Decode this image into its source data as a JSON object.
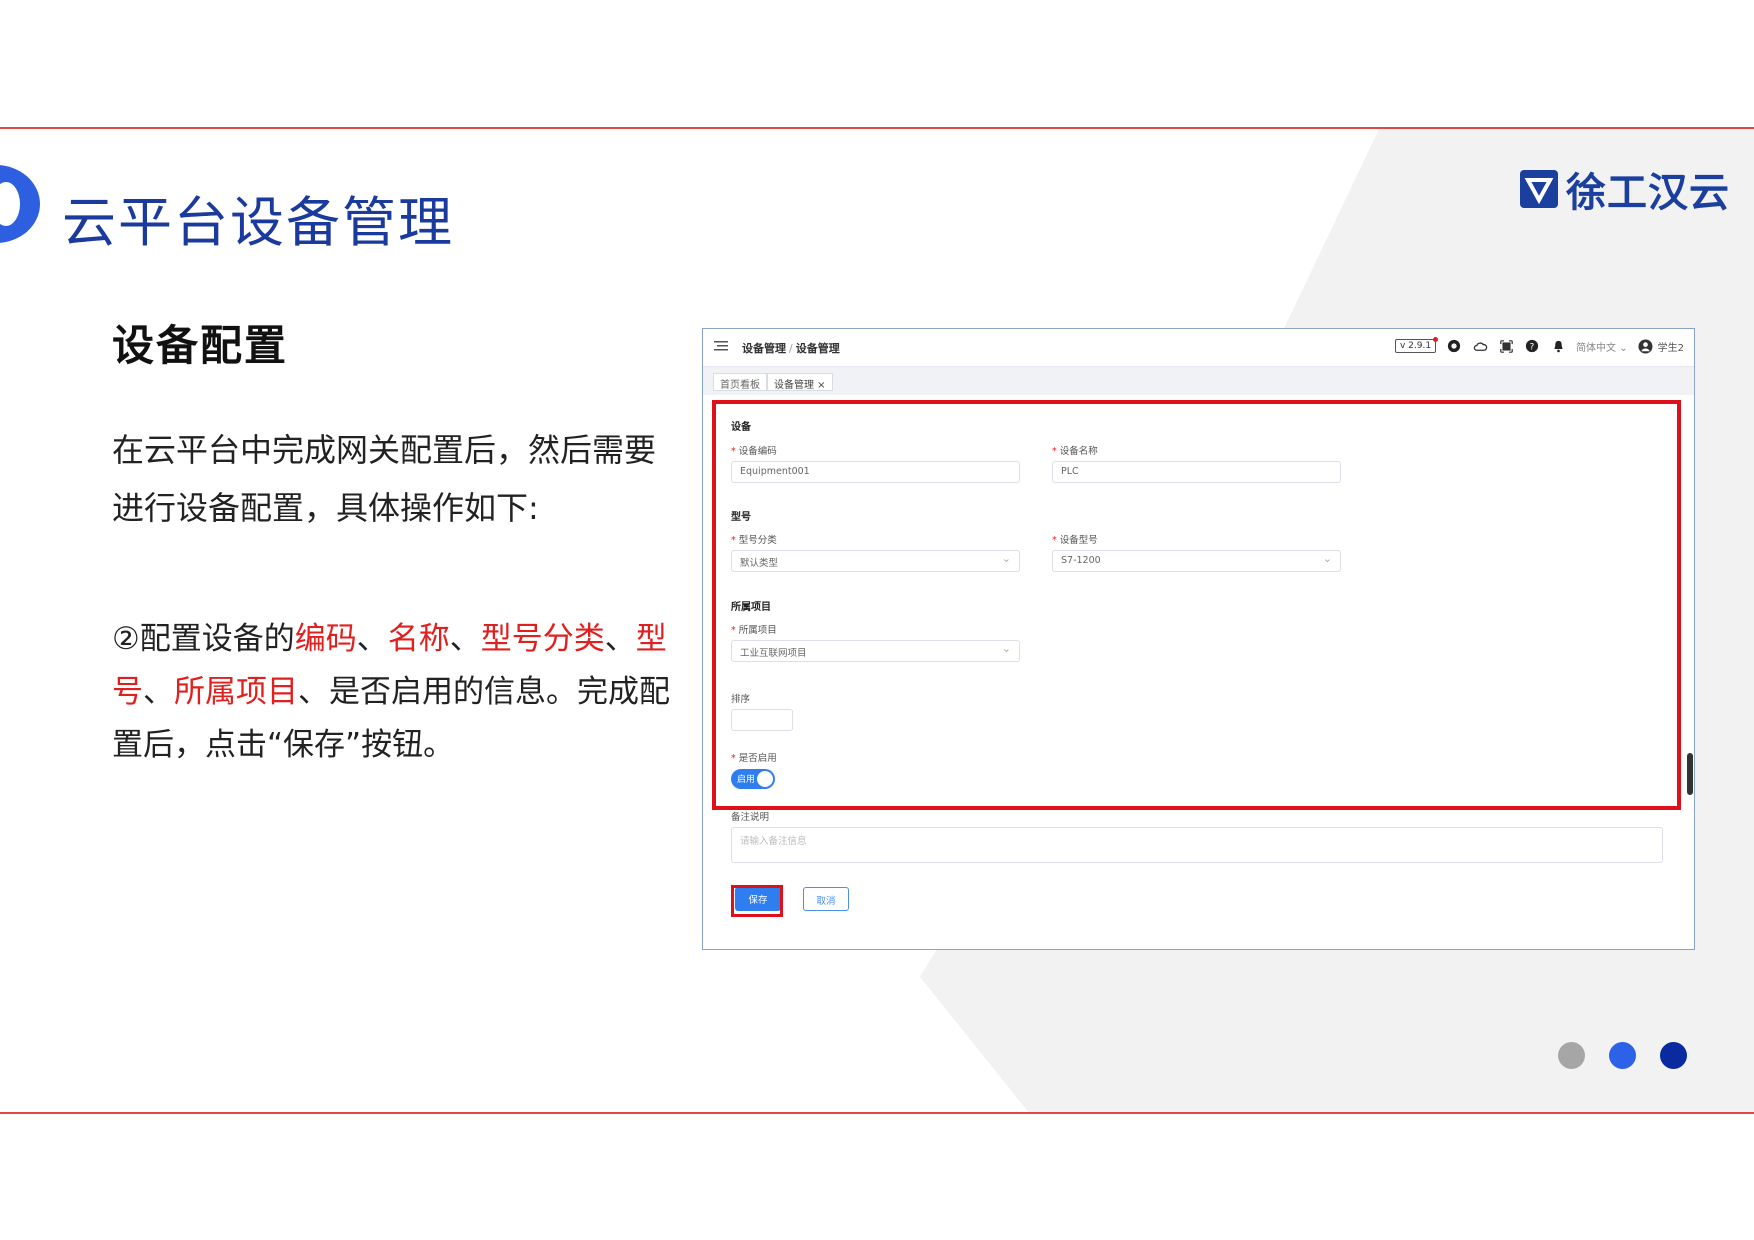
{
  "slide": {
    "title": "云平台设备管理",
    "logo_text": "徐工汉云",
    "section_title": "设备配置",
    "paragraph1": "在云平台中完成网关配置后，然后需要进行设备配置，具体操作如下:",
    "paragraph2_parts": {
      "p1": "②配置设备的",
      "p2": "编码",
      "p3": "、",
      "p4": "名称",
      "p5": "、",
      "p6": "型号分类",
      "p7": "、",
      "p8": "型号",
      "p9": "、",
      "p10": "所属项目",
      "p11": "、是否启用的信息。完成配置后，点击“保存”按钮。"
    },
    "accent_color": "#2d5fe0",
    "highlight_color": "#e0201f",
    "dot_colors": [
      "#a6a6a6",
      "#2d62e8",
      "#0a2aa0"
    ]
  },
  "app": {
    "breadcrumb": {
      "parent": "设备管理",
      "separator": "/",
      "current": "设备管理"
    },
    "version": "v 2.9.1",
    "language": "简体中文 ⌄",
    "user": "学生2",
    "tabs": [
      {
        "label": "首页看板"
      },
      {
        "label": "设备管理 ×"
      }
    ],
    "form": {
      "group_device": "设备",
      "code_label": "设备编码",
      "code_value": "Equipment001",
      "name_label": "设备名称",
      "name_value": "PLC",
      "group_model": "型号",
      "model_category_label": "型号分类",
      "model_category_value": "默认类型",
      "model_label": "设备型号",
      "model_value": "S7-1200",
      "group_project": "所属项目",
      "project_label": "所属项目",
      "project_value": "工业互联网项目",
      "sort_label": "排序",
      "sort_value": "",
      "enable_label": "是否启用",
      "enable_value": "启用",
      "remark_label": "备注说明",
      "remark_placeholder": "请输入备注信息",
      "save_label": "保存",
      "cancel_label": "取消"
    },
    "icons": [
      "menu-icon",
      "github-icon",
      "cloud-icon",
      "fullscreen-icon",
      "help-icon",
      "bell-icon",
      "user-avatar-icon"
    ]
  }
}
